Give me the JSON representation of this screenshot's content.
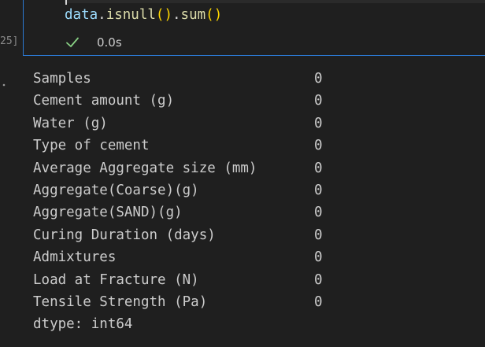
{
  "cell": {
    "code_tokens": {
      "var": "data",
      "dot1": ".",
      "fn1": "isnull",
      "paren1": "()",
      "dot2": ".",
      "fn2": "sum",
      "paren2": "()"
    },
    "execution_count": "25]",
    "status_icon": "check-icon",
    "exec_time": "0.0s"
  },
  "output": {
    "rows": [
      {
        "key": "Samples",
        "value": "0"
      },
      {
        "key": "Cement amount (g)",
        "value": "0"
      },
      {
        "key": "Water (g)",
        "value": "0"
      },
      {
        "key": "Type of cement",
        "value": "0"
      },
      {
        "key": "Average Aggregate size (mm)",
        "value": "0"
      },
      {
        "key": "Aggregate(Coarse)(g)",
        "value": "0"
      },
      {
        "key": "Aggregate(SAND)(g)",
        "value": "0"
      },
      {
        "key": "Curing Duration (days)",
        "value": "0"
      },
      {
        "key": "Admixtures",
        "value": "0"
      },
      {
        "key": "Load at Fracture (N)",
        "value": "0"
      },
      {
        "key": "Tensile Strength (Pa)",
        "value": "0"
      }
    ],
    "dtype": "dtype: int64"
  },
  "colors": {
    "background": "#1f1f1f",
    "cell_border": "#2b79d3",
    "success_green": "#89d185"
  }
}
